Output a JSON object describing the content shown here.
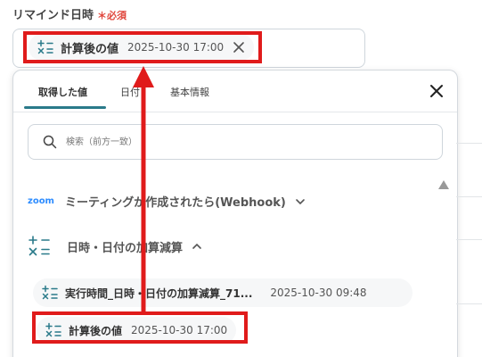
{
  "field": {
    "label": "リマインド日時",
    "required_mark": "＊必須"
  },
  "selected_chip": {
    "name": "計算後の値",
    "value": "2025-10-30 17:00",
    "icon": "math-operations-icon"
  },
  "dropdown": {
    "tabs": [
      {
        "label": "取得した値",
        "active": true
      },
      {
        "label": "日付",
        "active": false
      },
      {
        "label": "基本情報",
        "active": false
      }
    ],
    "search_placeholder": "検索（前方一致）",
    "sections": [
      {
        "icon": "zoom-logo",
        "logo_text": "zoom",
        "title": "ミーティングが作成されたら(Webhook)",
        "expanded": false
      },
      {
        "icon": "math-operations-icon",
        "title": "日時・日付の加算減算",
        "expanded": true
      }
    ],
    "items": [
      {
        "name": "実行時間_日時・日付の加算減算_71...",
        "value": "2025-10-30 09:48"
      },
      {
        "name": "計算後の値",
        "value": "2025-10-30 17:00"
      }
    ]
  },
  "colors": {
    "highlight": "#e01b1b",
    "accent_tab": "#2a7a8a",
    "required": "#e0463c",
    "zoom": "#2d8cff"
  }
}
